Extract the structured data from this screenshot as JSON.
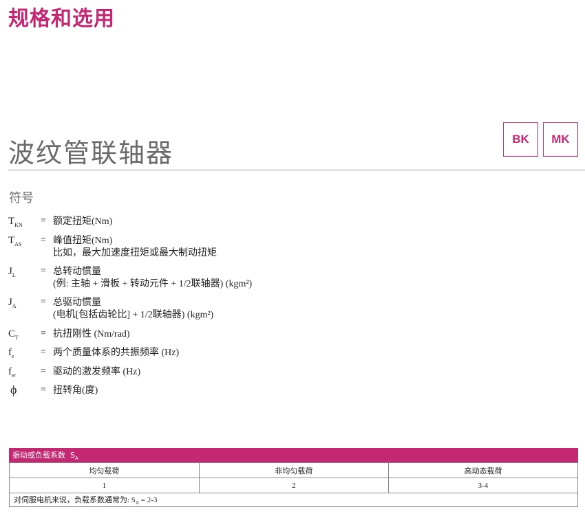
{
  "page_heading": "规格和选用",
  "product_title": "波纹管联轴器",
  "badges": {
    "bk": "BK",
    "mk": "MK"
  },
  "section_title": "符号",
  "equals_sign": "=",
  "symbols": [
    {
      "main": "T",
      "sub": "KN",
      "lines": [
        "额定扭矩(Nm)"
      ]
    },
    {
      "main": "T",
      "sub": "AS",
      "lines": [
        "峰值扭矩(Nm)",
        "比如，最大加速度扭矩或最大制动扭矩"
      ]
    },
    {
      "main": "J",
      "sub": "L",
      "lines": [
        "总转动惯量",
        "(例: 主轴 + 滑板 + 转动元件 + 1/2联轴器) (kgm²)"
      ]
    },
    {
      "main": "J",
      "sub": "A",
      "lines": [
        "总驱动惯量",
        "(电机[包括齿轮比] + 1/2联轴器) (kgm²)"
      ]
    },
    {
      "main": "C",
      "sub": "T",
      "lines": [
        "抗扭刚性 (Nm/rad)"
      ]
    },
    {
      "main": "f",
      "sub": "e",
      "lines": [
        "两个质量体系的共振频率 (Hz)"
      ]
    },
    {
      "main": "f",
      "sub": "er",
      "lines": [
        "驱动的激发频率 (Hz)"
      ]
    },
    {
      "main": "ϕ",
      "sub": "",
      "lines": [
        "扭转角(度)"
      ]
    }
  ],
  "load_table": {
    "title": "振动或负载系数",
    "title_symbol": "S",
    "title_symbol_sub": "A",
    "headers": [
      "均匀载荷",
      "非均匀载荷",
      "高动态载荷"
    ],
    "values": [
      "1",
      "2",
      "3-4"
    ],
    "note_prefix": "对伺服电机来说，负载系数通常为: S",
    "note_sub": "A",
    "note_suffix": " = 2-3"
  }
}
